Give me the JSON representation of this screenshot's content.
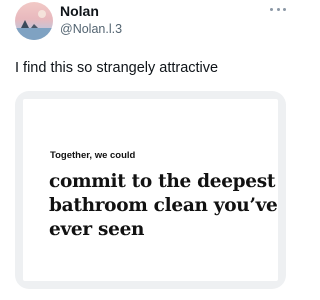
{
  "tweet": {
    "author": {
      "display_name": "Nolan",
      "handle": "@Nolan.l.3",
      "avatar_icon": "sunset-silhouette-avatar"
    },
    "more_icon": "more-dots-icon",
    "text": "I find this so strangely attractive",
    "card": {
      "kicker": "Together, we could",
      "headline": "commit to the deepest bathroom clean you’ve ever seen"
    }
  },
  "colors": {
    "text_primary": "#0f1419",
    "text_secondary": "#536471",
    "card_frame": "#eef0f2",
    "background": "#ffffff"
  }
}
